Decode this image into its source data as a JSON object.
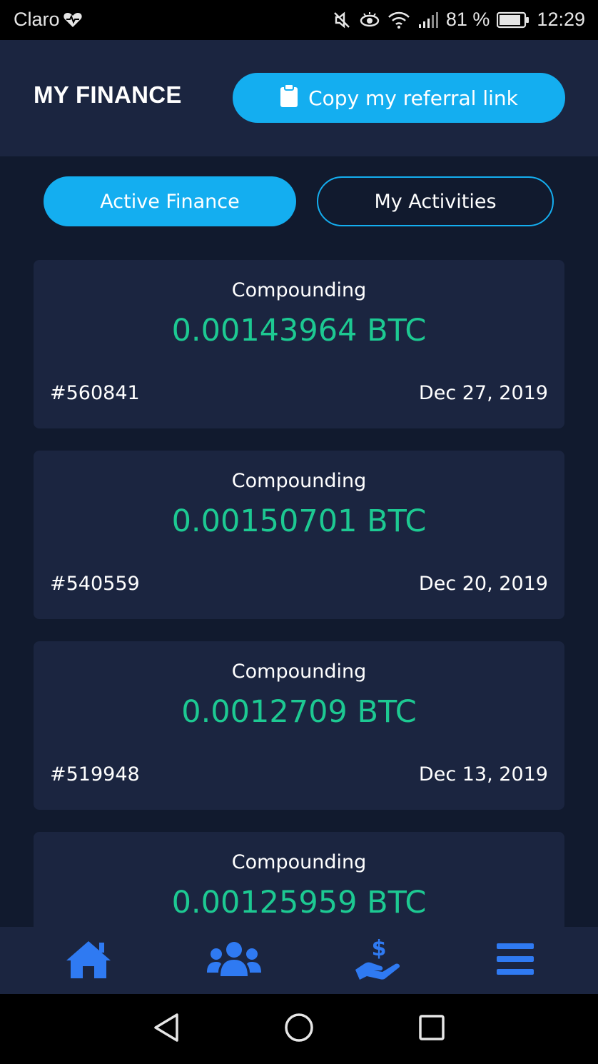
{
  "status_bar": {
    "carrier": "Claro",
    "battery_percent": "81 %",
    "time": "12:29"
  },
  "header": {
    "title": "MY FINANCE",
    "referral_button": "Copy my referral link"
  },
  "tabs": [
    {
      "label": "Active Finance",
      "active": true
    },
    {
      "label": "My Activities",
      "active": false
    }
  ],
  "cards": [
    {
      "type": "Compounding",
      "amount": "0.00143964 BTC",
      "id": "#560841",
      "date": "Dec 27, 2019"
    },
    {
      "type": "Compounding",
      "amount": "0.00150701 BTC",
      "id": "#540559",
      "date": "Dec 20, 2019"
    },
    {
      "type": "Compounding",
      "amount": "0.0012709 BTC",
      "id": "#519948",
      "date": "Dec 13, 2019"
    },
    {
      "type": "Compounding",
      "amount": "0.00125959 BTC",
      "id": "",
      "date": ""
    }
  ],
  "bottom_nav": {
    "items": [
      {
        "icon": "home-icon"
      },
      {
        "icon": "users-icon"
      },
      {
        "icon": "finance-hand-dollar-icon"
      },
      {
        "icon": "menu-icon"
      }
    ]
  },
  "colors": {
    "background": "#111a2e",
    "surface": "#1b2540",
    "accent": "#14aef0",
    "amount_green": "#1dc992",
    "nav_icon_blue": "#2f7af2"
  }
}
